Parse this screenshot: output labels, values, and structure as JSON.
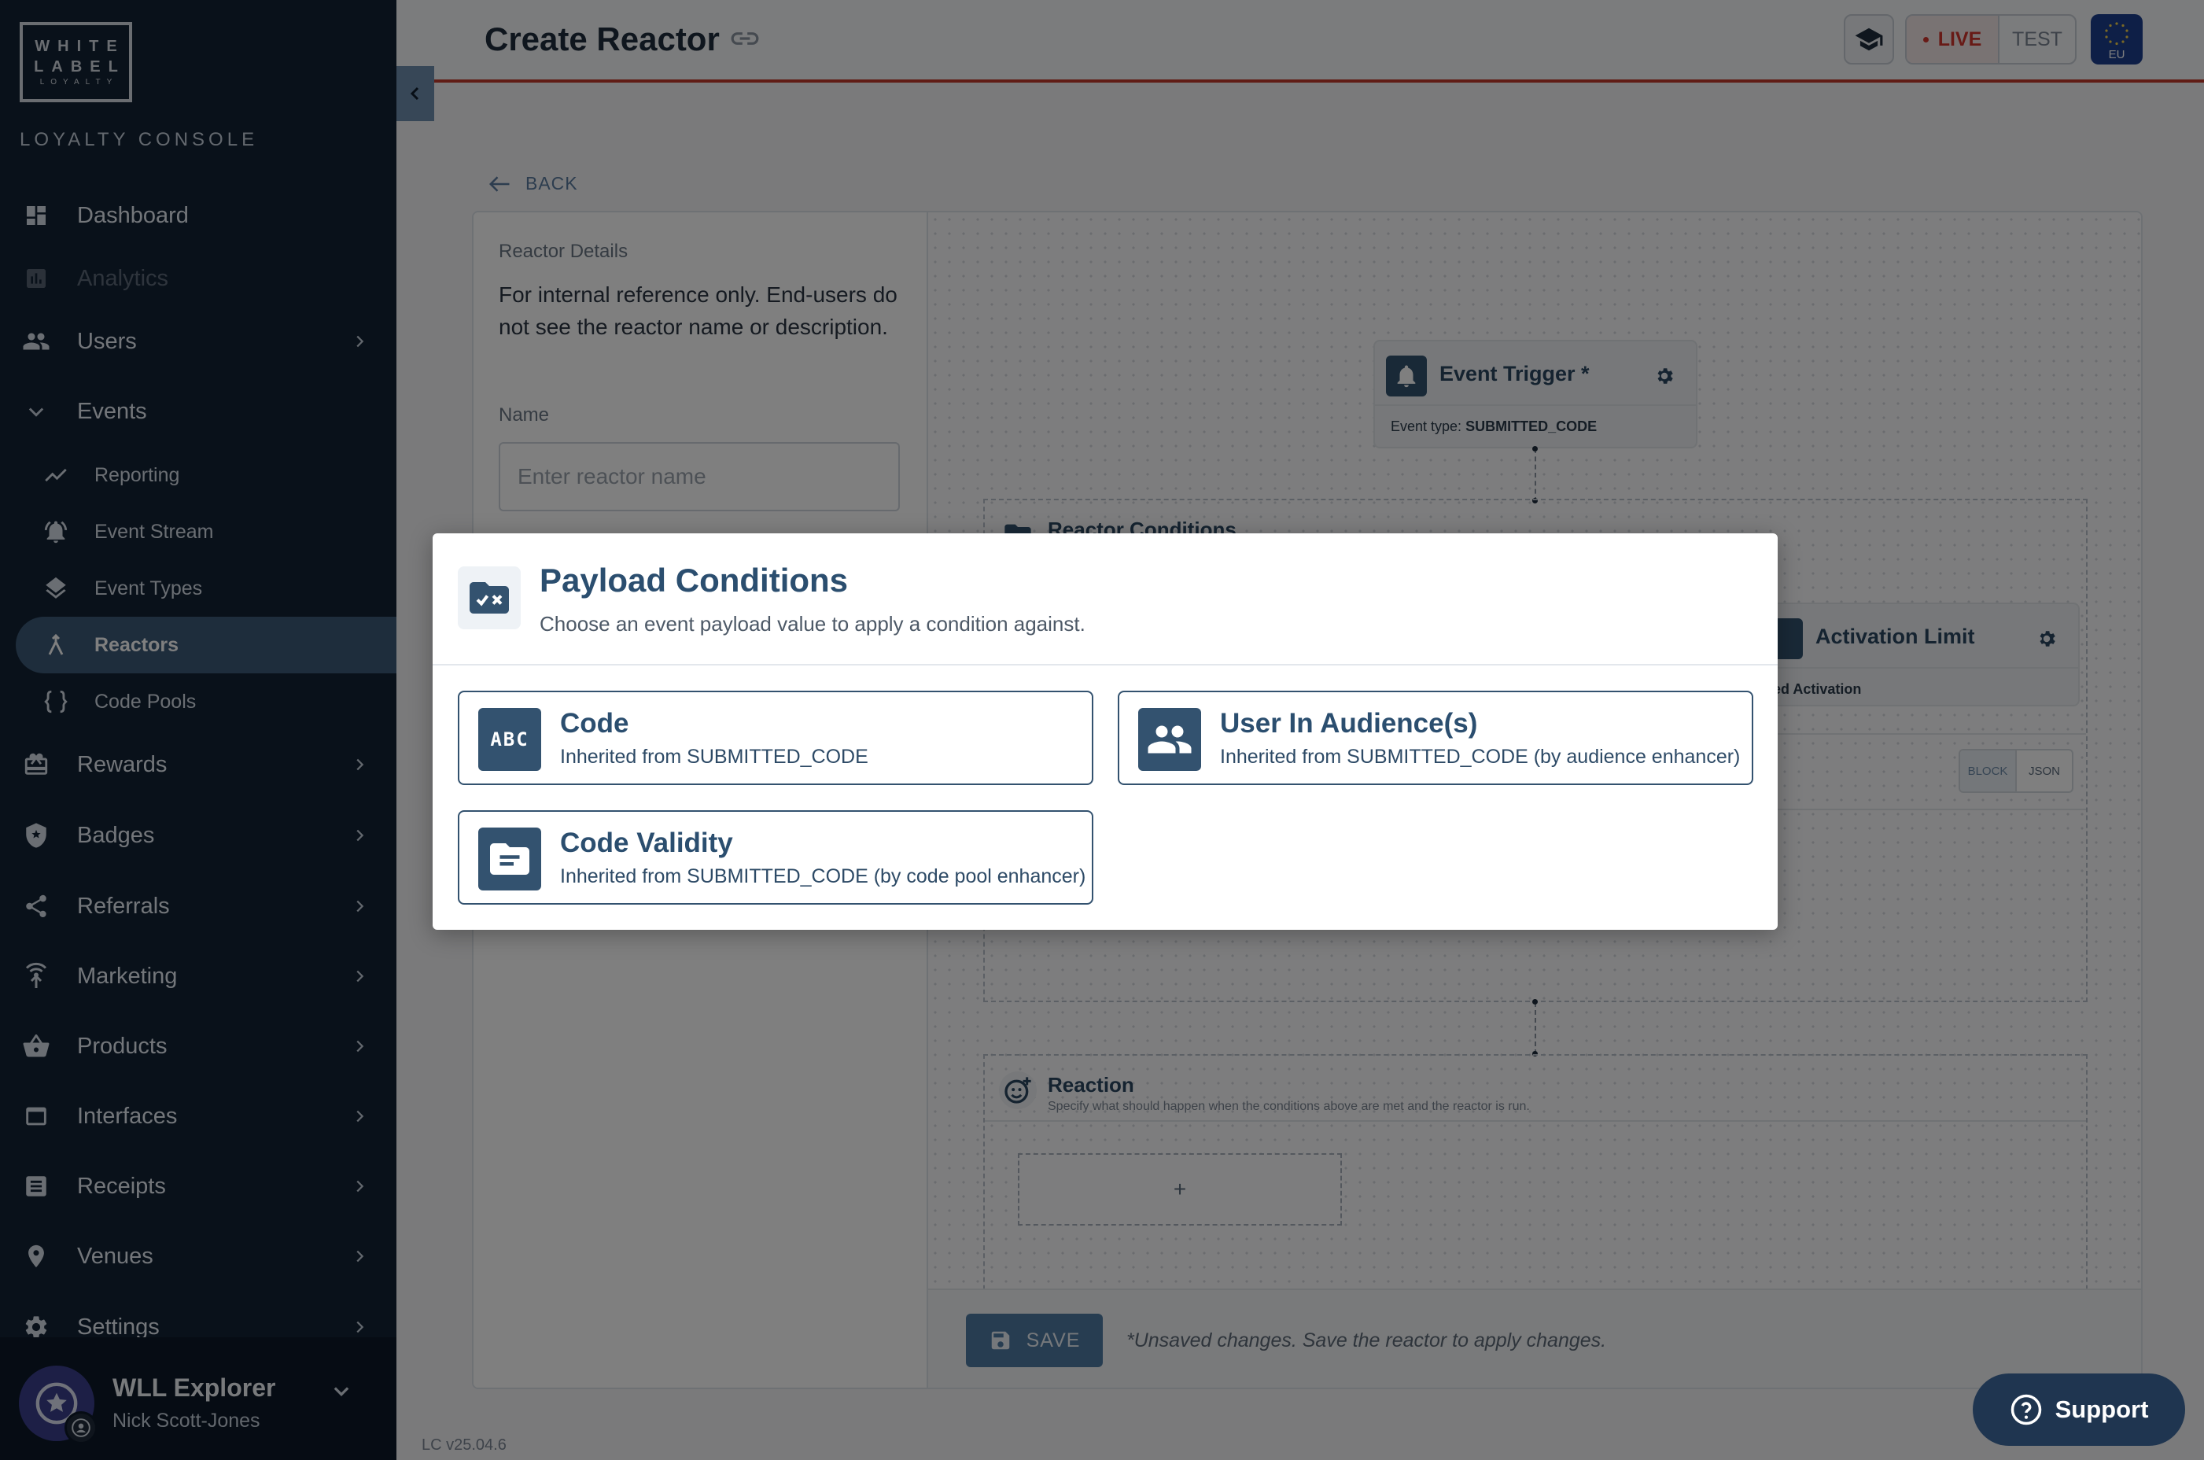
{
  "sidebar": {
    "logo": {
      "line1": "WHITE",
      "line2": "LABEL",
      "line3": "LOYALTY"
    },
    "console_title": "LOYALTY CONSOLE",
    "items": {
      "dashboard": "Dashboard",
      "analytics": "Analytics",
      "users": "Users",
      "events": "Events",
      "reporting": "Reporting",
      "event_stream": "Event Stream",
      "event_types": "Event Types",
      "reactors": "Reactors",
      "code_pools": "Code Pools",
      "rewards": "Rewards",
      "badges": "Badges",
      "referrals": "Referrals",
      "marketing": "Marketing",
      "products": "Products",
      "interfaces": "Interfaces",
      "receipts": "Receipts",
      "venues": "Venues",
      "settings": "Settings"
    },
    "user": {
      "name": "WLL Explorer",
      "subtitle": "Nick Scott-Jones"
    }
  },
  "header": {
    "title": "Create Reactor",
    "env_live": "LIVE",
    "env_test": "TEST",
    "region": "EU"
  },
  "main": {
    "back_label": "BACK",
    "details": {
      "title": "Reactor Details",
      "description": "For internal reference only. End-users do not see the reactor name or description.",
      "name_label": "Name",
      "name_placeholder": "Enter reactor name"
    },
    "canvas": {
      "event_trigger": {
        "title": "Event Trigger *",
        "type_label": "Event type:",
        "type_value": "SUBMITTED_CODE"
      },
      "reactor_conditions": {
        "title": "Reactor Conditions"
      },
      "activation_limit": {
        "title": "Activation Limit",
        "sub": "nited Activation"
      },
      "mode_block": "BLOCK",
      "mode_json": "JSON",
      "reaction": {
        "title": "Reaction",
        "subtitle": "Specify what should happen when the conditions above are met and the reactor is run.",
        "add": "+"
      }
    },
    "save_label": "SAVE",
    "unsaved_note": "*Unsaved changes. Save the reactor to apply changes."
  },
  "footer": {
    "version": "LC v25.04.6",
    "support": "Support"
  },
  "modal": {
    "title": "Payload Conditions",
    "subtitle": "Choose an event payload value to apply a condition against.",
    "options": [
      {
        "title": "Code",
        "subtitle": "Inherited from SUBMITTED_CODE",
        "icon_text": "ABC"
      },
      {
        "title": "User In Audience(s)",
        "subtitle": "Inherited from SUBMITTED_CODE (by audience enhancer)"
      },
      {
        "title": "Code Validity",
        "subtitle": "Inherited from SUBMITTED_CODE (by code pool enhancer)"
      }
    ]
  },
  "colors": {
    "sidebar_bg": "#122235",
    "accent": "#33526f",
    "live": "#d0342c",
    "active_item": "#3c5a78"
  }
}
